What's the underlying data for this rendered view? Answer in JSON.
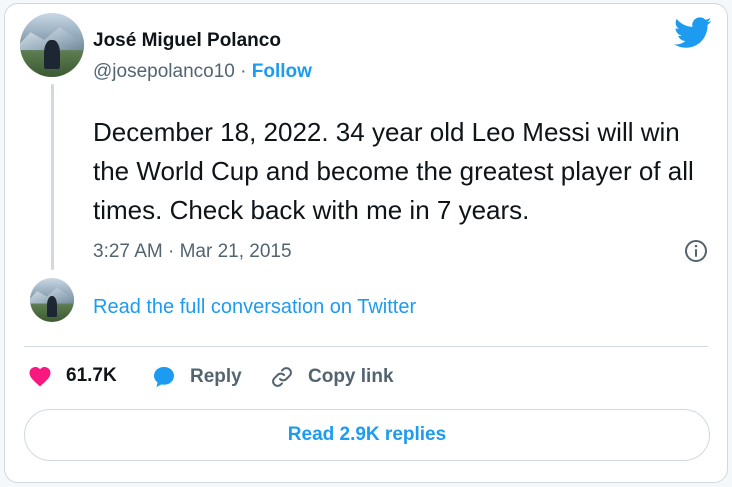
{
  "author": {
    "name": "José Miguel Polanco",
    "handle": "@josepolanco10",
    "separator": "·",
    "follow_label": "Follow"
  },
  "tweet": {
    "text": "December 18, 2022. 34 year old Leo Messi will win the World Cup and become the greatest player of all times. Check back with me in 7 years.",
    "timestamp": "3:27 AM · Mar 21, 2015"
  },
  "conversation_link": "Read the full conversation on Twitter",
  "actions": {
    "likes": "61.7K",
    "reply_label": "Reply",
    "copy_link_label": "Copy link"
  },
  "replies_button": "Read 2.9K replies",
  "colors": {
    "accent": "#1d9bf0",
    "like": "#f91880",
    "text": "#0f1419",
    "muted": "#536471",
    "border": "#cfd9de"
  },
  "icons": [
    "twitter-bird-icon",
    "info-icon",
    "heart-icon",
    "reply-bubble-icon",
    "link-icon"
  ]
}
